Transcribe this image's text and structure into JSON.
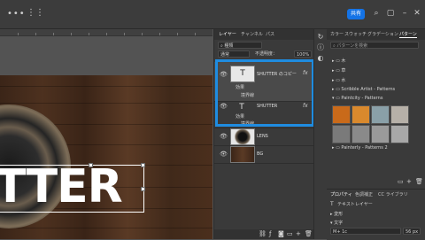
{
  "topbar": {
    "menu_dots": "•••",
    "grid_dots": "⋮⋮",
    "share_label": "共有"
  },
  "layers_panel": {
    "tabs": [
      "レイヤー",
      "チャンネル",
      "パス"
    ],
    "kind_filter": "種類",
    "blend_mode": "通常",
    "opacity_label": "不透明度：",
    "opacity_value": "100%",
    "lock_label": "ロック：",
    "fill_label": "塗り：",
    "fill_value": "100%",
    "layers": [
      {
        "name": "SHUTTER のコピー",
        "thumb": "T",
        "fx": "fx",
        "effects_label": "効果",
        "stroke_label": "境界線"
      },
      {
        "name": "SHUTTER",
        "thumb": "T",
        "fx": "fx",
        "effects_label": "効果",
        "stroke_label": "境界線"
      },
      {
        "name": "LENS"
      },
      {
        "name": "BG"
      }
    ],
    "bottom_icons": [
      "link-icon",
      "fx-icon",
      "mask-icon",
      "adjustment-icon",
      "folder-icon",
      "new-layer-icon",
      "trash-icon"
    ]
  },
  "libraries_panel": {
    "tabs": [
      "カラー",
      "スウォッチ",
      "グラデーション",
      "パターン"
    ],
    "search_placeholder": "パターンを検索",
    "folders": [
      "木",
      "草",
      "水",
      "Scribble Artist - Patterns",
      "Paintcity - Patterns",
      "Painterly - Patterns 2"
    ],
    "swatches": [
      "#c96a1a",
      "#d9892d",
      "#8aa0a8",
      "#b6b0a8",
      "#7a7a7a",
      "#8a8a8a",
      "#9a9a9a",
      "#a8a8a8"
    ]
  },
  "properties_panel": {
    "tabs": [
      "プロパティ",
      "色調補正",
      "CC ライブラリ"
    ],
    "layer_type": "テキストレイヤー",
    "transform_label": "変形",
    "char_label": "文字",
    "font_size": "56 px",
    "font_name": "M+ 1c"
  },
  "canvas": {
    "headline": "TTER",
    "colors": {
      "text": "#ffffff",
      "wood_dark": "#3b2518",
      "wood_light": "#5a3a25"
    }
  }
}
